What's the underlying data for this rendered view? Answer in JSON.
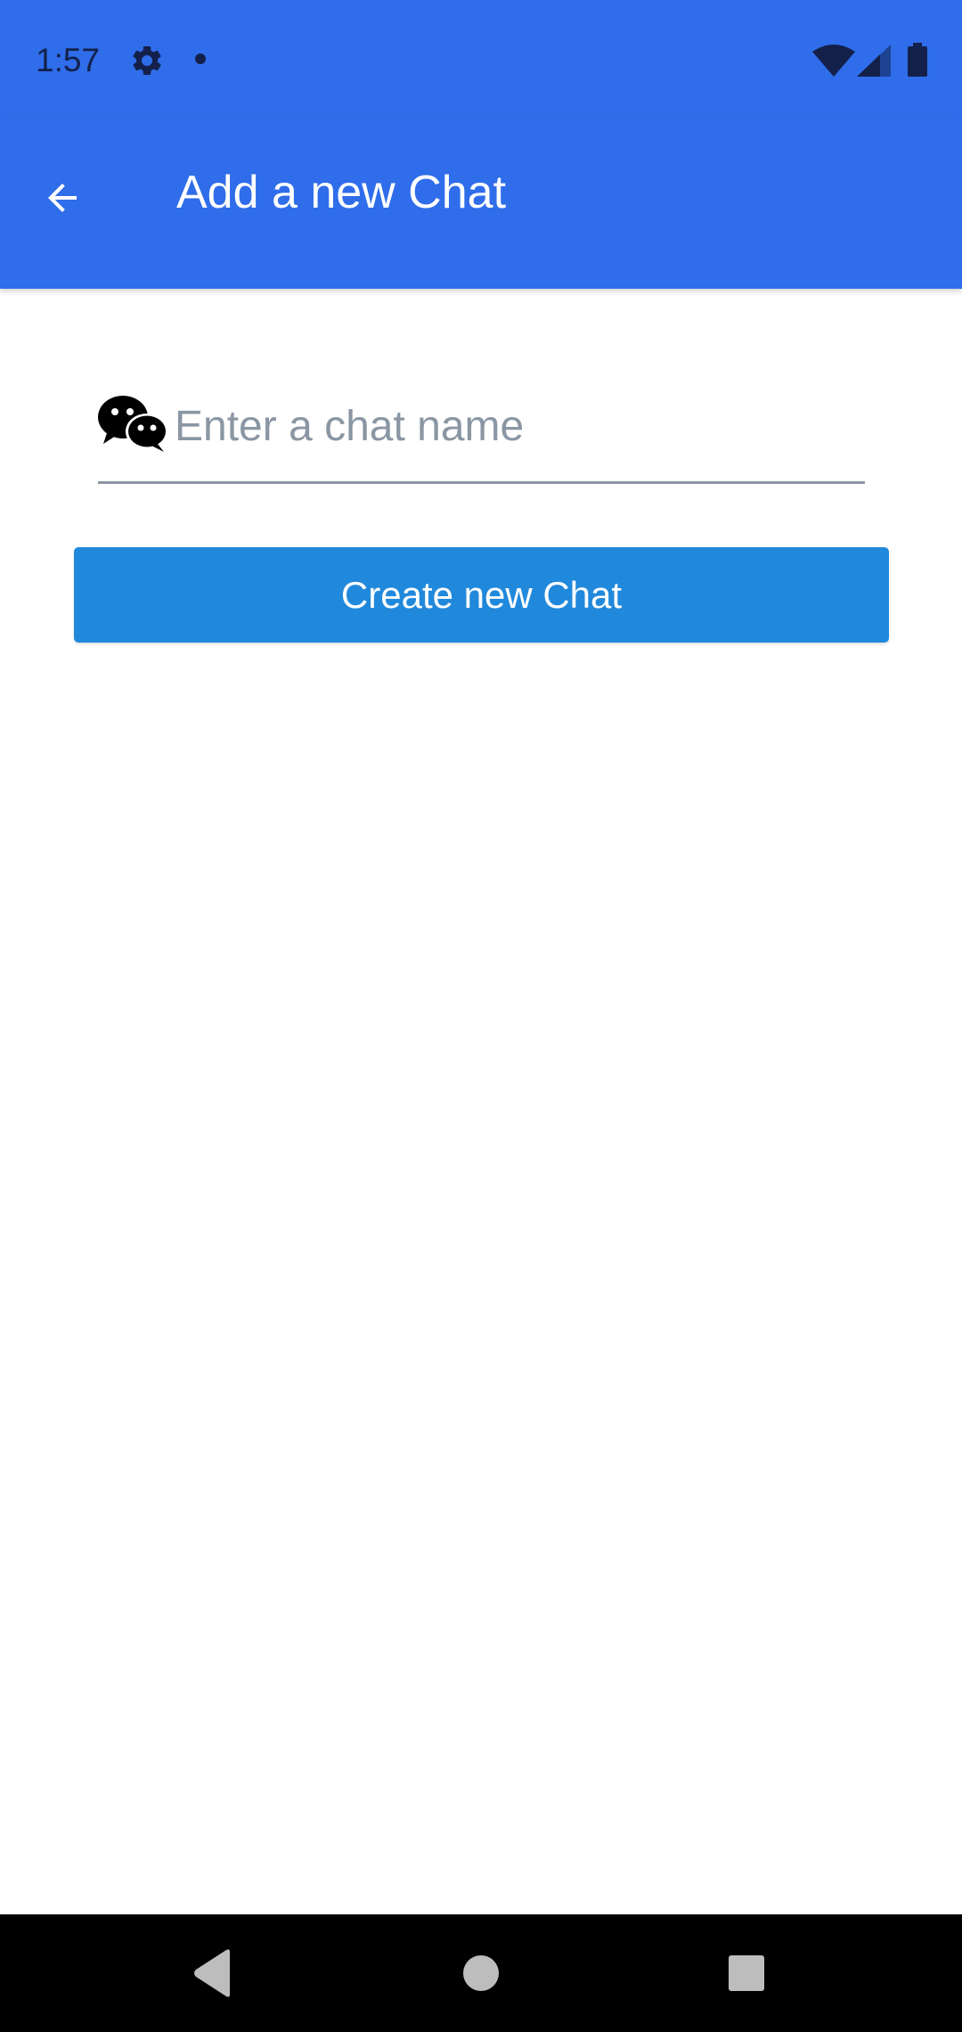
{
  "status_bar": {
    "time": "1:57",
    "icons": [
      "gear-icon",
      "notification-dot-icon",
      "wifi-icon",
      "cell-signal-icon",
      "battery-icon"
    ],
    "background_color": "#2f6dea",
    "icon_color": "#13214a"
  },
  "app_bar": {
    "title": "Add a new Chat",
    "back_icon": "arrow-back-icon",
    "background_color": "#2f6dea"
  },
  "form": {
    "chat_name": {
      "icon": "wechat-icon",
      "value": "",
      "placeholder": "Enter a chat name"
    },
    "create_button_label": "Create new Chat",
    "button_color": "#2189dc"
  },
  "nav_bar": {
    "icons": [
      "nav-back-icon",
      "nav-home-icon",
      "nav-recents-icon"
    ]
  }
}
